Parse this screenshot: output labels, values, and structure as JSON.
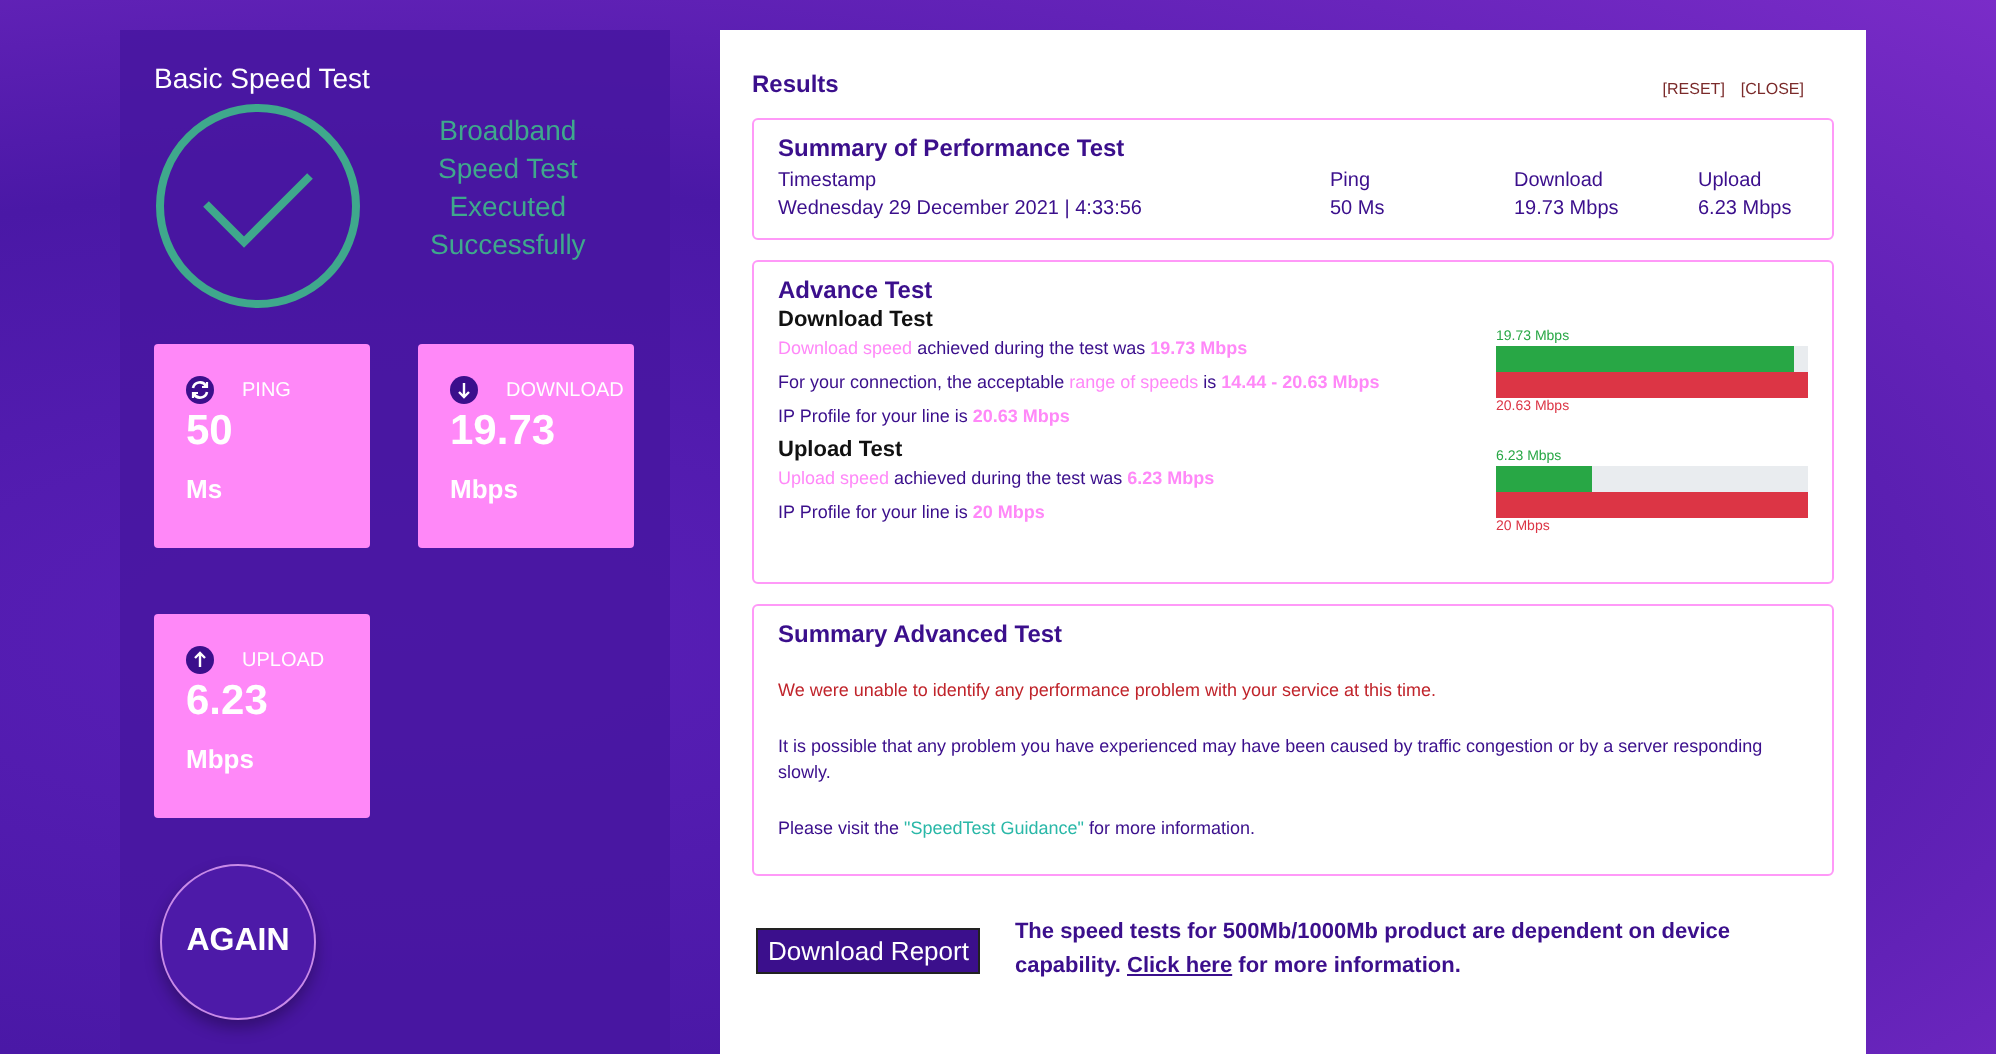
{
  "basic": {
    "title": "Basic Speed Test",
    "status_lines": [
      "Broadband",
      "Speed Test",
      "Executed",
      "Successfully"
    ],
    "metrics": [
      {
        "kind": "ping",
        "label": "PING",
        "value": "50",
        "unit": "Ms"
      },
      {
        "kind": "download",
        "label": "DOWNLOAD",
        "value": "19.73",
        "unit": "Mbps"
      },
      {
        "kind": "upload",
        "label": "UPLOAD",
        "value": "6.23",
        "unit": "Mbps"
      }
    ],
    "again_button": "AGAIN"
  },
  "results": {
    "title": "Results",
    "actions": [
      "[RESET]",
      "[CLOSE]"
    ],
    "summary": {
      "title": "Summary of Performance Test",
      "columns": [
        {
          "label": "Timestamp",
          "value": "Wednesday 29 December 2021 | 4:33:56"
        },
        {
          "label": "Ping",
          "value": "50 Ms"
        },
        {
          "label": "Download",
          "value": "19.73 Mbps"
        },
        {
          "label": "Upload",
          "value": "6.23 Mbps"
        }
      ]
    },
    "advance": {
      "title": "Advance Test",
      "tests": [
        {
          "title": "Download Test",
          "sentences": [
            [
              {
                "kind": "highlight",
                "text": "Download speed"
              },
              {
                "kind": "plain",
                "text": " achieved during the test was "
              },
              {
                "kind": "value",
                "text": "19.73 Mbps"
              }
            ],
            [
              {
                "kind": "plain",
                "text": "For your connection, the acceptable "
              },
              {
                "kind": "highlight",
                "text": "range of speeds"
              },
              {
                "kind": "plain",
                "text": " is "
              },
              {
                "kind": "value",
                "text": "14.44 - 20.63 Mbps"
              }
            ],
            [
              {
                "kind": "plain",
                "text": "IP Profile for your line is "
              },
              {
                "kind": "value",
                "text": "20.63 Mbps"
              }
            ]
          ],
          "measured_label": "19.73 Mbps",
          "level": 0.956,
          "profile_label": "20.63 Mbps"
        },
        {
          "title": "Upload Test",
          "sentences": [
            [
              {
                "kind": "highlight",
                "text": "Upload speed"
              },
              {
                "kind": "plain",
                "text": " achieved during the test was "
              },
              {
                "kind": "value",
                "text": "6.23 Mbps"
              }
            ],
            [
              {
                "kind": "plain",
                "text": "IP Profile for your line is "
              },
              {
                "kind": "value",
                "text": "20 Mbps"
              }
            ]
          ],
          "measured_label": "6.23 Mbps",
          "level": 0.31,
          "profile_label": "20 Mbps"
        }
      ]
    },
    "summary_advanced": {
      "title": "Summary Advanced Test",
      "paragraphs": [
        {
          "kind": "alert",
          "parts": [
            {
              "kind": "plain",
              "text": "We were unable to identify any performance problem with your service at this time."
            }
          ]
        },
        {
          "kind": "info",
          "parts": [
            {
              "kind": "plain",
              "text": "It is possible that any problem you have experienced may have been caused by traffic congestion or by a server responding slowly."
            }
          ]
        },
        {
          "kind": "info",
          "parts": [
            {
              "kind": "plain",
              "text": "Please visit the "
            },
            {
              "kind": "link",
              "text": "\"SpeedTest Guidance\""
            },
            {
              "kind": "plain",
              "text": " for more information."
            }
          ]
        }
      ]
    },
    "download_report_button": "Download Report",
    "note": [
      {
        "kind": "plain",
        "text": "The speed tests for 500Mb/1000Mb product are dependent on device capability. "
      },
      {
        "kind": "link",
        "text": "Click here"
      },
      {
        "kind": "plain",
        "text": " for more information."
      }
    ]
  }
}
